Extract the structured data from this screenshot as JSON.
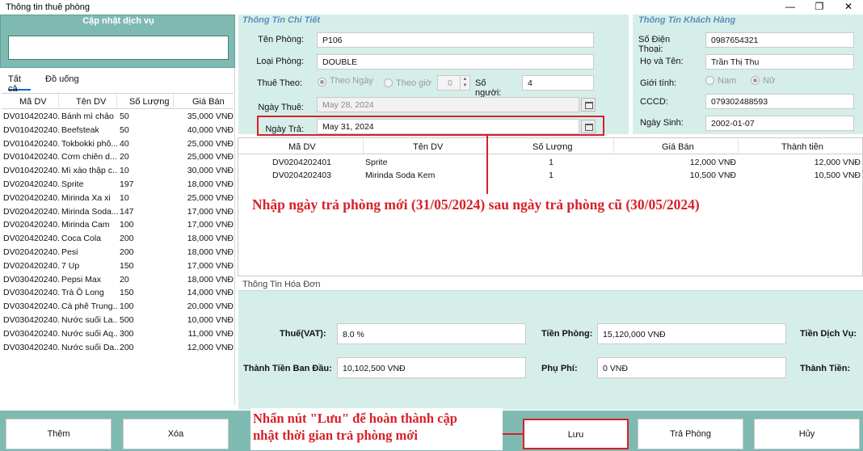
{
  "window": {
    "title": "Thông tin thuê phòng",
    "controls": [
      "—",
      "❐",
      "✕"
    ]
  },
  "service_panel": {
    "header": "Cập nhật dịch vụ",
    "search_value": "",
    "tabs": [
      "Tất cả",
      "Đồ uống"
    ],
    "columns": [
      "Mã DV",
      "Tên DV",
      "Số Lượng",
      "Giá Bán"
    ],
    "rows": [
      {
        "code": "DV010420240...",
        "name": "Bánh mì chảo",
        "qty": "50",
        "price": "35,000 VNĐ"
      },
      {
        "code": "DV010420240...",
        "name": "Beefsteak",
        "qty": "50",
        "price": "40,000 VNĐ"
      },
      {
        "code": "DV010420240...",
        "name": "Tokbokki phô...",
        "qty": "40",
        "price": "25,000 VNĐ"
      },
      {
        "code": "DV010420240...",
        "name": "Cơm chiên d...",
        "qty": "20",
        "price": "25,000 VNĐ"
      },
      {
        "code": "DV010420240...",
        "name": "Mì xào thập c...",
        "qty": "10",
        "price": "30,000 VNĐ"
      },
      {
        "code": "DV020420240...",
        "name": "Sprite",
        "qty": "197",
        "price": "18,000 VNĐ"
      },
      {
        "code": "DV020420240...",
        "name": "Mirinda Xa xi",
        "qty": "10",
        "price": "25,000 VNĐ"
      },
      {
        "code": "DV020420240...",
        "name": "Mirinda Soda...",
        "qty": "147",
        "price": "17,000 VNĐ"
      },
      {
        "code": "DV020420240...",
        "name": "Mirinda Cam",
        "qty": "100",
        "price": "17,000 VNĐ"
      },
      {
        "code": "DV020420240...",
        "name": "Coca Cola",
        "qty": "200",
        "price": "18,000 VNĐ"
      },
      {
        "code": "DV020420240...",
        "name": "Pesi",
        "qty": "200",
        "price": "18,000 VNĐ"
      },
      {
        "code": "DV020420240...",
        "name": "7 Up",
        "qty": "150",
        "price": "17,000 VNĐ"
      },
      {
        "code": "DV030420240...",
        "name": "Pepsi Max",
        "qty": "20",
        "price": "18,000 VNĐ"
      },
      {
        "code": "DV030420240...",
        "name": "Trà Ô Long",
        "qty": "150",
        "price": "14,000 VNĐ"
      },
      {
        "code": "DV030420240...",
        "name": "Cà phê Trung...",
        "qty": "100",
        "price": "20,000 VNĐ"
      },
      {
        "code": "DV030420240...",
        "name": "Nước suối La...",
        "qty": "500",
        "price": "10,000 VNĐ"
      },
      {
        "code": "DV030420240...",
        "name": "Nước suối Aq...",
        "qty": "300",
        "price": "11,000 VNĐ"
      },
      {
        "code": "DV030420240...",
        "name": "Nước suối Da...",
        "qty": "200",
        "price": "12,000 VNĐ"
      }
    ]
  },
  "detail": {
    "group_title": "Thông Tin Chi Tiết",
    "room_label": "Tên Phòng:",
    "room_value": "P106",
    "type_label": "Loại Phòng:",
    "type_value": "DOUBLE",
    "rent_by_label": "Thuê Theo:",
    "by_day": "Theo Ngày",
    "by_hour": "Theo giờ",
    "hours_value": "0",
    "people_label": "Số người:",
    "people_value": "4",
    "checkin_label": "Ngày Thuê:",
    "checkin_value": "May 28, 2024",
    "checkout_label": "Ngày Trả:",
    "checkout_value": "May 31, 2024"
  },
  "customer": {
    "group_title": "Thông Tin Khách Hàng",
    "phone_label": "Số Điện Thoại:",
    "phone_value": "0987654321",
    "name_label": "Họ và Tên:",
    "name_value": "Trần Thị Thu",
    "gender_label": "Giới tính:",
    "male": "Nam",
    "female": "Nữ",
    "id_label": "CCCD:",
    "id_value": "079302488593",
    "dob_label": "Ngày Sinh:",
    "dob_value": "2002-01-07"
  },
  "used_services": {
    "columns": [
      "Mã DV",
      "Tên DV",
      "Số Lượng",
      "Giá Bán",
      "Thành tiền"
    ],
    "rows": [
      {
        "code": "DV0204202401",
        "name": "Sprite",
        "qty": "1",
        "price": "12,000 VNĐ",
        "total": "12,000 VNĐ"
      },
      {
        "code": "DV0204202403",
        "name": "Mirinda Soda Kem",
        "qty": "1",
        "price": "10,500 VNĐ",
        "total": "10,500 VNĐ"
      }
    ]
  },
  "invoice": {
    "group_title": "Thông Tin Hóa Đơn",
    "vat_label": "Thuế(VAT):",
    "vat_value": "8.0 %",
    "room_fee_label": "Tiền Phòng:",
    "room_fee_value": "15,120,000 VNĐ",
    "service_fee_label": "Tiền Dịch Vụ:",
    "initial_label": "Thành Tiền Ban Đầu:",
    "initial_value": "10,102,500 VNĐ",
    "surcharge_label": "Phụ Phí:",
    "surcharge_value": "0 VNĐ",
    "total_label": "Thành Tiền:"
  },
  "buttons": {
    "add": "Thêm",
    "delete": "Xóa",
    "save": "Lưu",
    "checkout": "Trả Phòng",
    "cancel": "Hủy"
  },
  "annotations": {
    "date_note": "Nhập ngày trả phòng mới (31/05/2024) sau ngày trả phòng cũ (30/05/2024)",
    "save_note_line1": "Nhấn nút \"Lưu\" để hoàn thành cập",
    "save_note_line2": "nhật thời gian trả phòng mới"
  },
  "colors": {
    "panel_teal": "#7fbab2",
    "form_bg": "#d6eeea",
    "annotation_red": "#d82028",
    "group_title": "#5a8fbd"
  }
}
